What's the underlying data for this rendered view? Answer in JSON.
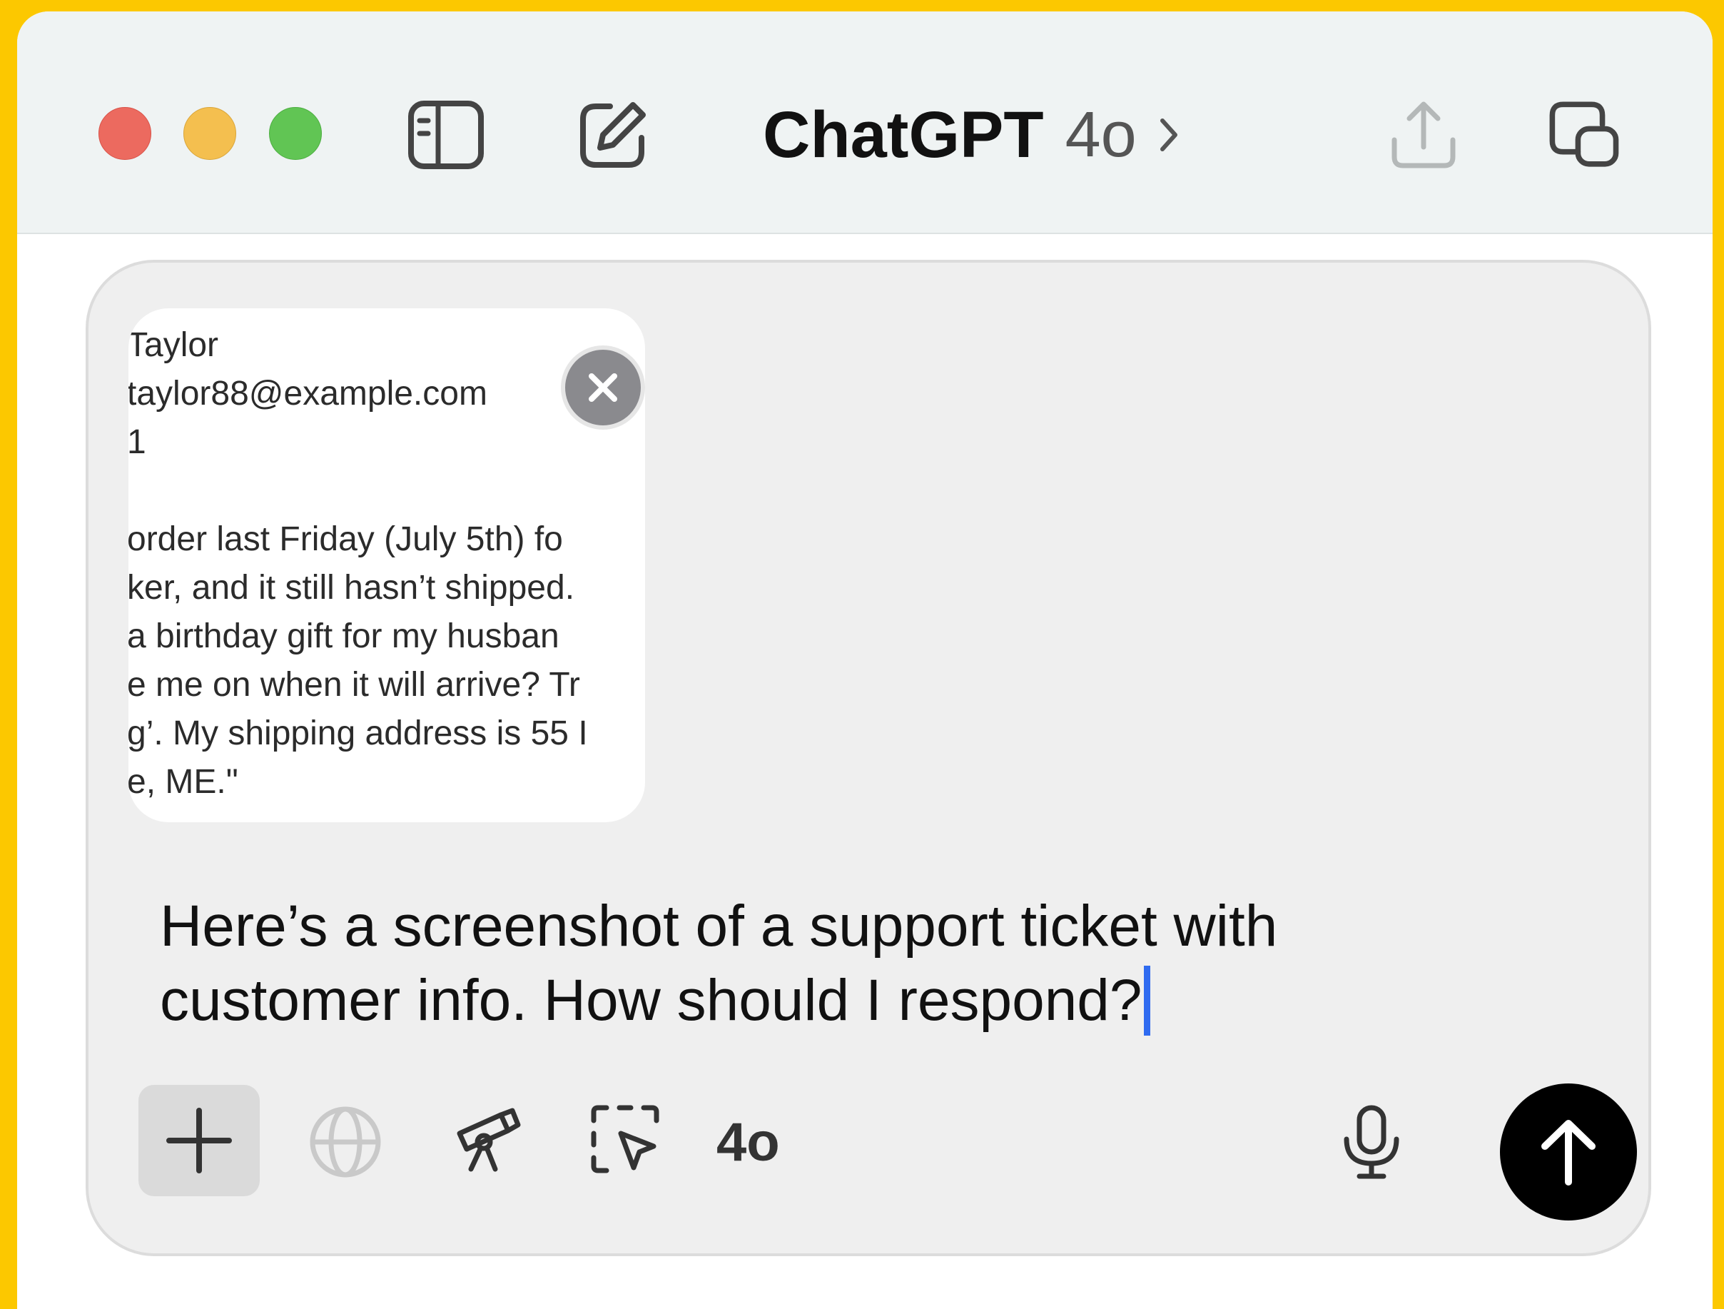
{
  "window": {
    "title": "ChatGPT",
    "model": "4o"
  },
  "attachment": {
    "lines": [
      "Taylor",
      "taylor88@example.com",
      "1",
      "",
      "order last Friday (July 5th) fo",
      "ker, and it still hasn’t shipped.",
      "a birthday gift for my husban",
      "e me on when it will arrive? Tr",
      "g’. My shipping address is 55 I",
      "e, ME.\""
    ]
  },
  "composer": {
    "prompt_line1": "Here’s a screenshot of a support ticket with",
    "prompt_line2": "customer info. How should I respond?",
    "model_label": "4o"
  },
  "colors": {
    "frame": "#FCC800",
    "caret": "#2F6BF0",
    "send_button": "#000000"
  },
  "icons": [
    "sidebar-toggle-icon",
    "new-chat-icon",
    "chevron-right-icon",
    "share-icon",
    "new-window-icon",
    "close-icon",
    "plus-icon",
    "globe-icon",
    "telescope-icon",
    "select-area-icon",
    "microphone-icon",
    "arrow-up-icon"
  ]
}
